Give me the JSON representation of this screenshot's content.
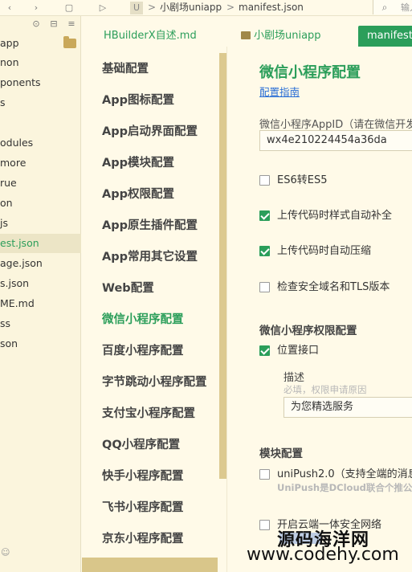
{
  "toolbar": {
    "crumb_project": "小剧场uniapp",
    "crumb_file": "manifest.json",
    "search_placeholder": "输入",
    "colors": {
      "accent": "#2b9e5a",
      "background": "#fffae8"
    }
  },
  "explorer": {
    "files": [
      "app",
      "non",
      "ponents",
      "s",
      "odules",
      "more",
      "rue",
      "on",
      "js",
      "est.json",
      "age.json",
      "s.json",
      "ME.md",
      "ss",
      "son"
    ],
    "active_index": 9
  },
  "tabs": [
    {
      "label": "HBuilderX自述.md"
    },
    {
      "label": "小剧场uniapp"
    },
    {
      "label": "manifest."
    }
  ],
  "nav": {
    "items": [
      "基础配置",
      "App图标配置",
      "App启动界面配置",
      "App模块配置",
      "App权限配置",
      "App原生插件配置",
      "App常用其它设置",
      "Web配置",
      "微信小程序配置",
      "百度小程序配置",
      "字节跳动小程序配置",
      "支付宝小程序配置",
      "QQ小程序配置",
      "快手小程序配置",
      "飞书小程序配置",
      "京东小程序配置"
    ],
    "active_index": 8
  },
  "content": {
    "title": "微信小程序配置",
    "guide_link": "配置指南",
    "appid_label": "微信小程序AppID（请在微信开发",
    "appid_value": "wx4e210224454a36da",
    "options": [
      {
        "label": "ES6转ES5",
        "checked": false
      },
      {
        "label": "上传代码时样式自动补全",
        "checked": true
      },
      {
        "label": "上传代码时自动压缩",
        "checked": true
      },
      {
        "label": "检查安全域名和TLS版本",
        "checked": false
      }
    ],
    "perm_title": "微信小程序权限配置",
    "perm_location": "位置接口",
    "perm_location_checked": true,
    "desc_label": "描述",
    "desc_hint": "必填，权限申请原因",
    "desc_value": "为您精选服务",
    "module_title": "模块配置",
    "unipush_label": "uniPush2.0（支持全端的消息",
    "unipush_hint": "UniPush是DCloud联合个推公",
    "secure_label": "开启云端一体安全网络"
  },
  "watermark": {
    "line1": "源码海洋网",
    "line2": "www.codehy.com"
  }
}
